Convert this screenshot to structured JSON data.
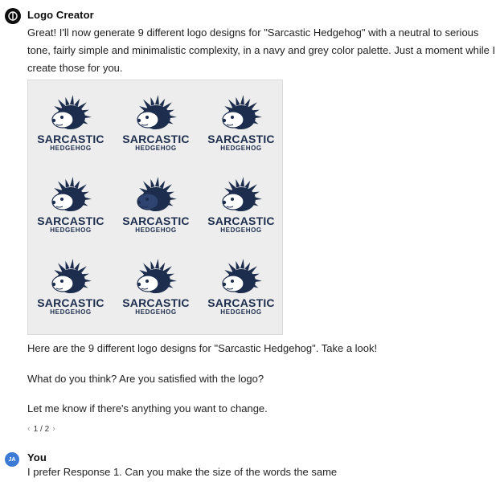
{
  "assistant": {
    "name": "Logo Creator",
    "intro": "Great! I'll now generate 9 different logo designs for \"Sarcastic Hedgehog\" with a neutral to serious tone, fairly simple and minimalistic complexity, in a navy and grey color palette. Just a moment while I create those for you.",
    "followup_1": "Here are the 9 different logo designs for \"Sarcastic Hedgehog\". Take a look!",
    "followup_2": "What do you think? Are you satisfied with the logo?",
    "followup_3": "Let me know if there's anything you want to change.",
    "pager": "1 / 2"
  },
  "logo_grid": {
    "word_main": "SARCASTIC",
    "word_sub": "HEDGEHOG",
    "navy": "#1d2d4d",
    "grey": "#ededed"
  },
  "user": {
    "initials": "JA",
    "name": "You",
    "message": "I prefer Response 1. Can you make the size of the words the same"
  }
}
